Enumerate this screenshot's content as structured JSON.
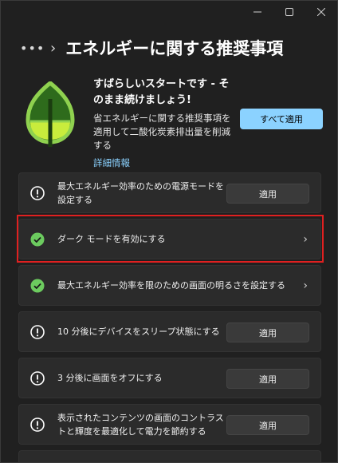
{
  "window": {
    "controls": [
      "minimize",
      "maximize",
      "close"
    ]
  },
  "header": {
    "more_label": "•••",
    "separator": "›",
    "title": "エネルギーに関する推奨事項"
  },
  "hero": {
    "title": "すばらしいスタートです - そのまま続けましょう!",
    "description": "省エネルギーに関する推奨事項を適用して二酸化炭素排出量を削減する",
    "link": "詳細情報",
    "apply_all": "すべて適用"
  },
  "recommendations": [
    {
      "label": "最大エネルギー効率のための電源モードを設定する",
      "status": "info",
      "action": "適用"
    },
    {
      "label": "ダーク モードを有効にする",
      "status": "done",
      "action": "chevron"
    },
    {
      "label": "最大エネルギー効率を限のための画面の明るさを設定する",
      "status": "done",
      "action": "chevron"
    },
    {
      "label": "10 分後にデバイスをスリープ状態にする",
      "status": "info",
      "action": "適用"
    },
    {
      "label": "3 分後に画面をオフにする",
      "status": "info",
      "action": "適用"
    },
    {
      "label": "表示されたコンテンツの画面のコントラストと輝度を最適化して電力を節約する",
      "status": "info",
      "action": "適用"
    }
  ],
  "colors": {
    "accent": "#8bd2ff",
    "success": "#6ccb5f",
    "highlight": "#e02020",
    "leaf": "#8fd14f"
  }
}
